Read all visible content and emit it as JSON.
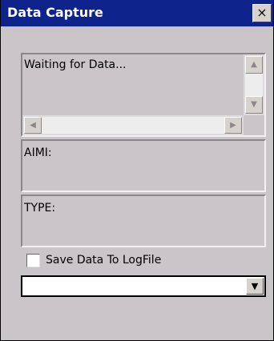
{
  "window": {
    "title": "Data Capture",
    "close_glyph": "×"
  },
  "data_box": {
    "text": "Waiting for Data...",
    "scroll_up_glyph": "▲",
    "scroll_down_glyph": "▼",
    "scroll_left_glyph": "◀",
    "scroll_right_glyph": "▶"
  },
  "aimi_box": {
    "label": "AIMI:"
  },
  "type_box": {
    "label": "TYPE:"
  },
  "save_option": {
    "label": "Save Data To LogFile",
    "checked": false
  },
  "combo": {
    "value": "",
    "arrow_glyph": "▼"
  },
  "colors": {
    "titlebar": "#0f238c",
    "window_bg": "#c9c5c9"
  }
}
